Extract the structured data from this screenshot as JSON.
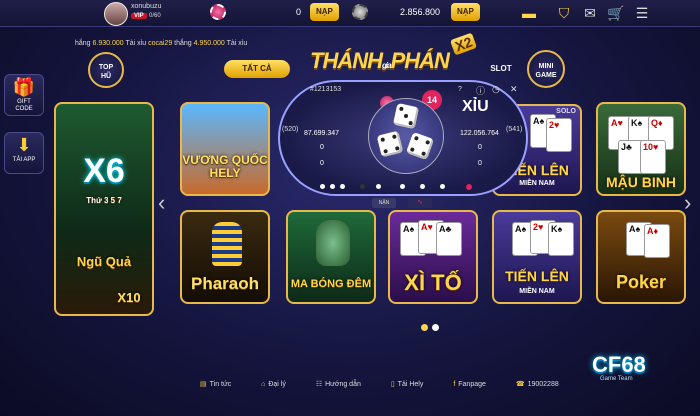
{
  "header": {
    "username": "xonubuzu",
    "vip_badge": "VIP",
    "vip_value": "0/60",
    "chip_balance": "0",
    "nap_label": "NẠP",
    "coin_balance": "2.856.800",
    "nap2_label": "NẠP"
  },
  "ticker": {
    "p1": "hắng ",
    "v1": "6.930.000",
    "p2": " Tài xỉu ",
    "user": "cocai29",
    "p3": " thắng ",
    "v2": "4.950.000",
    "p4": " Tài xỉu"
  },
  "left": {
    "tophu_label": "TOP\nHŨ",
    "giftcode_label": "GIFT\nCODE",
    "taiapp_label": "TẢI APP"
  },
  "tabs": {
    "all": "TẤT CẢ",
    "slot": "SLOT",
    "minigame": "MINI\nGAME"
  },
  "banner": {
    "thanh": "THÁNH",
    "gia": "gia",
    "phan": "PHÁN",
    "x2": "X2"
  },
  "games": {
    "x6": {
      "title": "X6",
      "sub": "Thứ 3 5 7",
      "name": "Ngũ Quả",
      "mult": "X10"
    },
    "hely": {
      "title": "VƯƠNG QUỐC HELY"
    },
    "pharaoh": {
      "title": "Pharaoh"
    },
    "ma_bong_dem": {
      "title": "MA BÓNG ĐÊM"
    },
    "xito": {
      "title": "XÌ TỐ"
    },
    "tienlen_solo": {
      "title": "TIẾN LÊN",
      "sub": "MIỀN NAM",
      "tag": "SOLO"
    },
    "tienlen": {
      "title": "TIẾN LÊN",
      "sub": "MIỀN NAM"
    },
    "maubinh": {
      "title": "MẬU BINH"
    },
    "poker": {
      "title": "Poker"
    }
  },
  "taixiu": {
    "session": "#1213153",
    "help": "?",
    "timer": "14",
    "title": "XỈU",
    "left_count": "(520)",
    "left_total": "87.699.347",
    "left_bet1": "0",
    "left_bet2": "0",
    "right_count": "(541)",
    "right_total": "122.056.764",
    "right_bet1": "0",
    "right_bet2": "0",
    "toggle_label": "NẶN"
  },
  "footer": {
    "tintuc": "Tin tức",
    "daily": "Đại lý",
    "huongdan": "Hướng dẫn",
    "taihely": "Tải Hely",
    "fanpage": "Fanpage",
    "hotline": "19002288"
  },
  "watermark": {
    "brand": "CF68",
    "sub": "Game Team"
  }
}
